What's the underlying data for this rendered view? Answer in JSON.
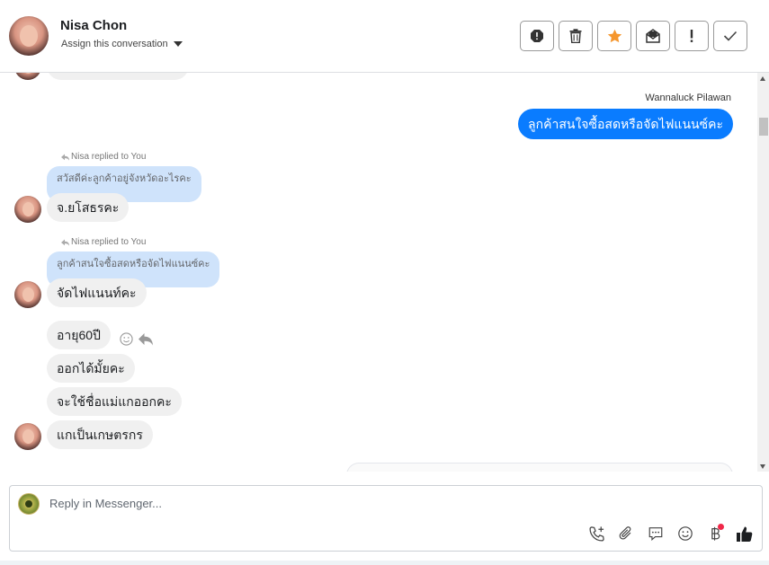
{
  "header": {
    "name": "Nisa Chon",
    "assign_label": "Assign this conversation",
    "actions": [
      {
        "icon": "spam-icon"
      },
      {
        "icon": "trash-icon"
      },
      {
        "icon": "star-icon",
        "color": "#f5962d"
      },
      {
        "icon": "mark-unread-icon"
      },
      {
        "icon": "exclamation-icon"
      },
      {
        "icon": "check-icon"
      }
    ]
  },
  "conversation": {
    "outgoing": {
      "sender": "Wannaluck Pilawan",
      "text": "ลูกค้าสนใจซื้อสดหรือจัดไฟแนนซ์คะ"
    },
    "replies": [
      {
        "replied_label": "Nisa replied to You",
        "quote": "สวัสดีค่ะลูกค้าอยู่จังหวัดอะไรคะ",
        "text": "จ.ยโสธรคะ"
      },
      {
        "replied_label": "Nisa replied to You",
        "quote": "ลูกค้าสนใจซื้อสดหรือจัดไฟแนนซ์คะ",
        "text": "จัดไฟแนนท์คะ"
      }
    ],
    "messages": [
      {
        "text": "อายุ60ปี"
      },
      {
        "text": "ออกได้มั้ยคะ"
      },
      {
        "text": "จะใช้ชื่อแม่แกออกคะ"
      },
      {
        "text": "แกเป็นเกษตรกร"
      }
    ]
  },
  "composer": {
    "placeholder": "Reply in Messenger...",
    "value": "",
    "tools": [
      "call-add-icon",
      "attachment-icon",
      "saved-replies-icon",
      "emoji-icon",
      "payment-baht-icon",
      "like-icon"
    ]
  },
  "colors": {
    "outgoing_bubble": "#0a7cff",
    "incoming_bubble": "#f0f0f0",
    "quote_bubble": "#cfe3fb",
    "notification_dot": "#f02849"
  }
}
